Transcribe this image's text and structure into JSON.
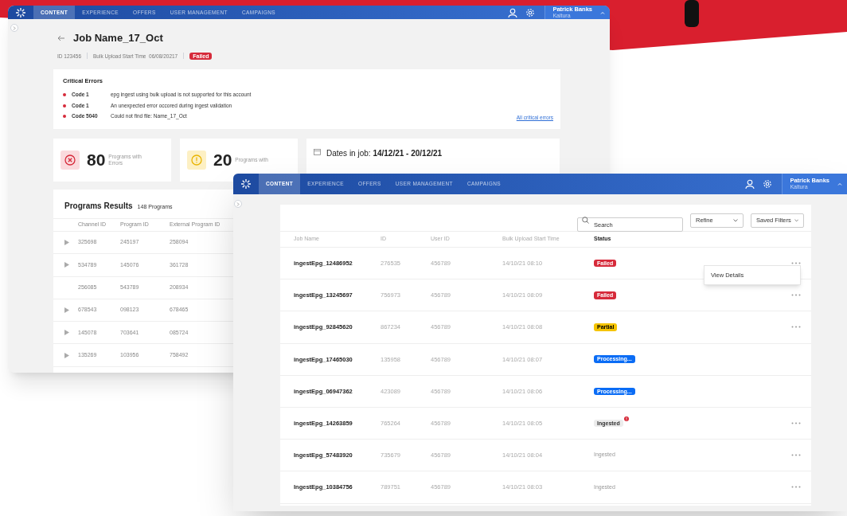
{
  "back_window": {
    "nav": {
      "tabs": [
        {
          "label": "CONTENT",
          "selected": true
        },
        {
          "label": "EXPERIENCE",
          "selected": false
        },
        {
          "label": "OFFERS",
          "selected": false
        },
        {
          "label": "USER MANAGEMENT",
          "selected": false
        },
        {
          "label": "CAMPAIGNS",
          "selected": false
        }
      ],
      "user": {
        "name": "Patrick Banks",
        "org": "Kaltura"
      }
    },
    "job": {
      "title": "Job Name_17_Oct",
      "id": "ID 123456",
      "start_time": "Bulk Upload Start Time  06/08/20217",
      "status": {
        "label": "Failed",
        "kind": "failed"
      }
    },
    "critical_errors": {
      "title": "Critical Errors",
      "items": [
        {
          "code": "Code 1",
          "message": "epg ingest using bulk upload is not supported for this account"
        },
        {
          "code": "Code 1",
          "message": "An unexpected error occored during ingest validation"
        },
        {
          "code": "Code 5040",
          "message": "Could not find file: Name_17_Oct"
        }
      ],
      "link": "All critical errors"
    },
    "stats": [
      {
        "kind": "error",
        "value": "80",
        "label": "Programs with Errors"
      },
      {
        "kind": "warning",
        "value": "20",
        "label": "Programs with"
      }
    ],
    "dates": "Dates in job: **14/12/21 - 20/12/21**",
    "results": {
      "title": "Programs Results",
      "count": "148 Programs",
      "columns": [
        "Channel ID",
        "Program ID",
        "External Program ID"
      ],
      "rows": [
        {
          "expandable": true,
          "cells": [
            "325698",
            "245197",
            "258094"
          ]
        },
        {
          "expandable": true,
          "cells": [
            "534789",
            "145076",
            "361728"
          ]
        },
        {
          "expandable": false,
          "cells": [
            "256085",
            "543789",
            "208934"
          ]
        },
        {
          "expandable": true,
          "cells": [
            "678543",
            "098123",
            "678465"
          ]
        },
        {
          "expandable": true,
          "cells": [
            "145078",
            "703641",
            "085724"
          ]
        },
        {
          "expandable": true,
          "cells": [
            "135269",
            "103956",
            "758492"
          ]
        }
      ]
    }
  },
  "front_window": {
    "nav": {
      "tabs": [
        {
          "label": "CONTENT",
          "selected": true
        },
        {
          "label": "EXPERIENCE",
          "selected": false
        },
        {
          "label": "OFFERS",
          "selected": false
        },
        {
          "label": "USER MANAGEMENT",
          "selected": false
        },
        {
          "label": "CAMPAIGNS",
          "selected": false
        }
      ],
      "user": {
        "name": "Patrick Banks",
        "org": "Kaltura"
      }
    },
    "search": {
      "placeholder": "Search"
    },
    "filters": [
      "Refine",
      "Saved Filters"
    ],
    "columns": [
      "Job Name",
      "ID",
      "User ID",
      "Bulk Upload Start Time",
      "Status"
    ],
    "rows": [
      {
        "cells": [
          "ingestEpg_12486952",
          "276535",
          "456789",
          "14/10/21 08:10"
        ],
        "status": {
          "label": "Failed",
          "kind": "failed",
          "alert": false
        },
        "menu": true
      },
      {
        "cells": [
          "ingestEpg_13245697",
          "756973",
          "456789",
          "14/10/21 08:09"
        ],
        "status": {
          "label": "Failed",
          "kind": "failed",
          "alert": false
        },
        "menu": true
      },
      {
        "cells": [
          "ingestEpg_92845620",
          "867234",
          "456789",
          "14/10/21 08:08"
        ],
        "status": {
          "label": "Partial",
          "kind": "partial",
          "alert": false
        },
        "menu": true
      },
      {
        "cells": [
          "ingestEpg_17465030",
          "135958",
          "456789",
          "14/10/21 08:07"
        ],
        "status": {
          "label": "Processing...",
          "kind": "processing",
          "alert": false
        },
        "menu": false
      },
      {
        "cells": [
          "ingestEpg_06947362",
          "423089",
          "456789",
          "14/10/21 08:06"
        ],
        "status": {
          "label": "Processing...",
          "kind": "processing",
          "alert": false
        },
        "menu": false
      },
      {
        "cells": [
          "ingestEpg_14263859",
          "765264",
          "456789",
          "14/10/21 08:05"
        ],
        "status": {
          "label": "Ingested",
          "kind": "ingested",
          "alert": true
        },
        "menu": true
      },
      {
        "cells": [
          "IngestEpg_57483920",
          "735679",
          "456789",
          "14/10/21 08:04"
        ],
        "status": {
          "label": "Ingested",
          "kind": "ingested",
          "alert": false
        },
        "menu": true
      },
      {
        "cells": [
          "IngestEpg_10384756",
          "789751",
          "456789",
          "14/10/21 08:03"
        ],
        "status": {
          "label": "Ingested",
          "kind": "ingested",
          "alert": false
        },
        "menu": true
      }
    ],
    "context_menu": {
      "items": [
        "View Details"
      ]
    }
  }
}
